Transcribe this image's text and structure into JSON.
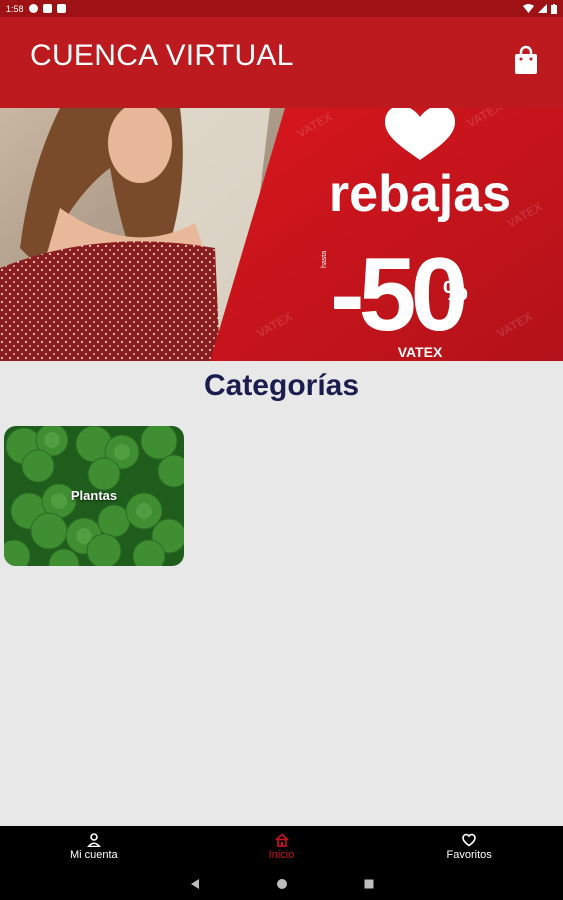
{
  "status_bar": {
    "time": "1:58"
  },
  "app_bar": {
    "title": "CUENCA VIRTUAL",
    "cart_icon": "shopping-bag-icon"
  },
  "banner": {
    "headline": "rebajas",
    "prefix": "hasta",
    "discount": "-50",
    "percent": "%",
    "brand": "VATEX",
    "watermark": "VATEX"
  },
  "categories": {
    "title": "Categorías",
    "items": [
      {
        "label": "Plantas"
      }
    ]
  },
  "bottom_nav": {
    "items": [
      {
        "label": "Mi cuenta",
        "icon": "person-icon"
      },
      {
        "label": "Inicio",
        "icon": "home-icon"
      },
      {
        "label": "Favoritos",
        "icon": "heart-icon"
      }
    ]
  },
  "colors": {
    "primary": "#bc1a1e",
    "status_bar": "#9e1216",
    "title_text": "#1b1d4e",
    "active_nav": "#c8151c"
  }
}
